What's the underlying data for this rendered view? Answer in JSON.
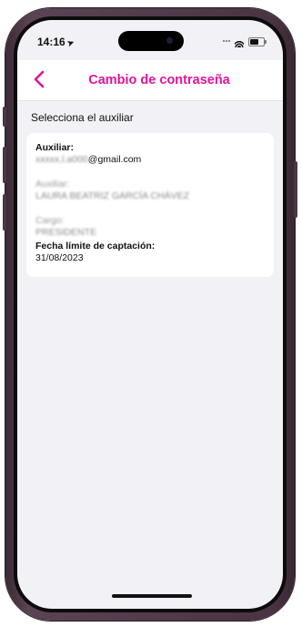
{
  "status_bar": {
    "time": "14:16"
  },
  "nav": {
    "title": "Cambio de contraseña",
    "accent_color": "#e0149a"
  },
  "section": {
    "title": "Selecciona el auxiliar"
  },
  "card": {
    "auxiliar_label": "Auxiliar:",
    "auxiliar_email_blurred": "xxxxx.l.a000",
    "auxiliar_email_domain": "@gmail.com",
    "name_label_blurred": "Auxiliar:",
    "name_value_blurred": "LAURA BEATRIZ GARCÍA CHÁVEZ",
    "cargo_label_blurred": "Cargo:",
    "cargo_value_blurred": "PRESIDENTE",
    "fecha_label": "Fecha límite de captación:",
    "fecha_value": "31/08/2023"
  }
}
